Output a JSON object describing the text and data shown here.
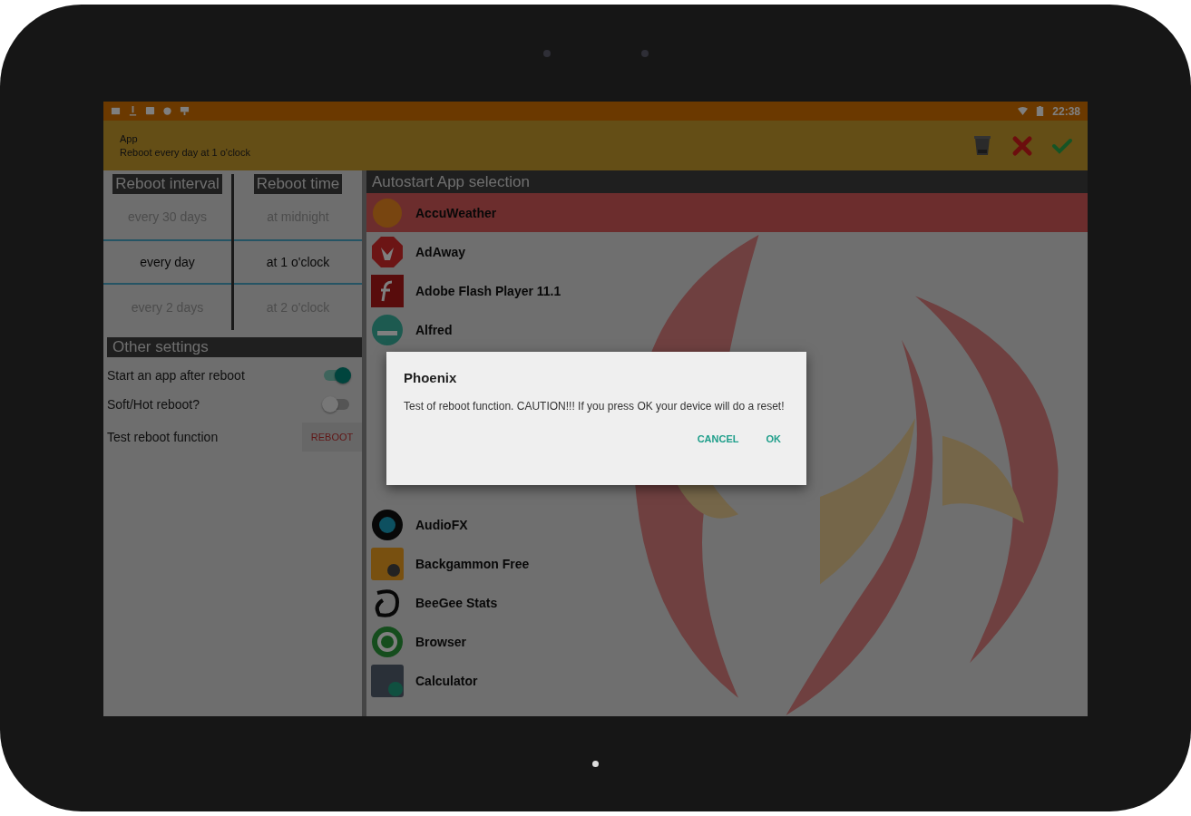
{
  "status_bar": {
    "time": "22:38"
  },
  "action_bar": {
    "title": "App",
    "subtitle": "Reboot every day at 1 o'clock"
  },
  "reboot_interval": {
    "header": "Reboot interval",
    "options": [
      {
        "label": "every 30 days",
        "selected": false
      },
      {
        "label": "every day",
        "selected": true
      },
      {
        "label": "every 2 days",
        "selected": false
      }
    ]
  },
  "reboot_time": {
    "header": "Reboot time",
    "options": [
      {
        "label": "at midnight",
        "selected": false
      },
      {
        "label": "at 1 o'clock",
        "selected": true
      },
      {
        "label": "at 2 o'clock",
        "selected": false
      }
    ]
  },
  "other_settings": {
    "header": "Other settings",
    "items": [
      {
        "kind": "switch",
        "label": "Start an app after reboot",
        "on": true
      },
      {
        "kind": "switch",
        "label": "Soft/Hot reboot?",
        "on": false
      },
      {
        "kind": "button",
        "label": "Test reboot function",
        "button": "REBOOT"
      }
    ]
  },
  "app_list": {
    "header": "Autostart App selection",
    "items": [
      {
        "label": "AccuWeather",
        "selected": true
      },
      {
        "label": "AdAway",
        "selected": false
      },
      {
        "label": "Adobe Flash Player 11.1",
        "selected": false
      },
      {
        "label": "Alfred",
        "selected": false
      },
      {
        "label": "AudioFX",
        "selected": false
      },
      {
        "label": "Backgammon Free",
        "selected": false
      },
      {
        "label": "BeeGee Stats",
        "selected": false
      },
      {
        "label": "Browser",
        "selected": false
      },
      {
        "label": "Calculator",
        "selected": false
      }
    ]
  },
  "dialog": {
    "title": "Phoenix",
    "message": "Test of reboot function. CAUTION!!! If you press OK your device will do a reset!",
    "buttons": [
      "CANCEL",
      "OK"
    ]
  }
}
